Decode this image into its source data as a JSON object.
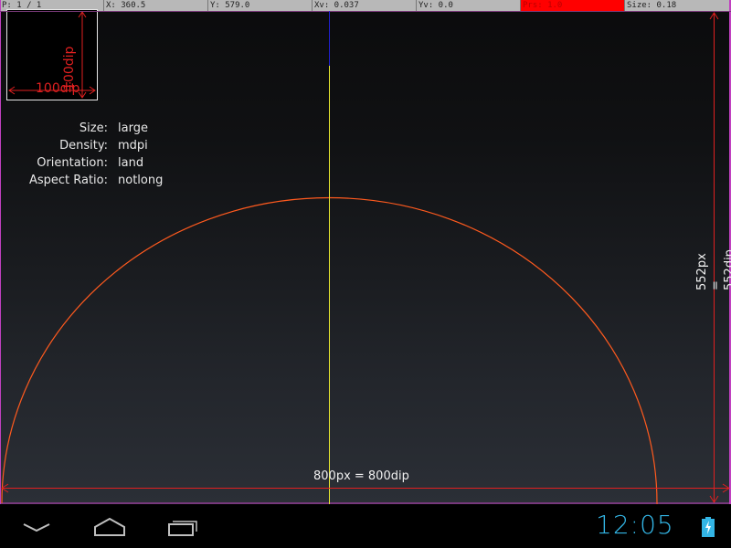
{
  "pointer_location": {
    "pointers": "P: 1 / 1",
    "x": "X: 360.5",
    "y": "Y: 579.0",
    "xv": "Xv: 0.037",
    "yv": "Yv: 0.0",
    "prs": "Prs: 1.0",
    "size": "Size: 0.18"
  },
  "dip_box": {
    "width_label": "100dip",
    "height_label": "100dip"
  },
  "screen_info": [
    {
      "key": "Size:",
      "value": "large"
    },
    {
      "key": "Density:",
      "value": "mdpi"
    },
    {
      "key": "Orientation:",
      "value": "land"
    },
    {
      "key": "Aspect Ratio:",
      "value": "notlong"
    }
  ],
  "dimensions": {
    "width_label": "800px = 800dip",
    "height_label": "552px = 552dip"
  },
  "navbar": {
    "back_icon": "back-icon",
    "home_icon": "home-icon",
    "recents_icon": "recents-icon",
    "clock": "12:05",
    "battery_icon": "battery-charging-icon"
  },
  "colors": {
    "clock": "#33b5e5",
    "arc": "#ff5a1e",
    "dim_lines": "#e02020",
    "crosshair_v": "#e8e830",
    "crosshair_h": "#2020d0",
    "boundary": "#c040c0"
  }
}
